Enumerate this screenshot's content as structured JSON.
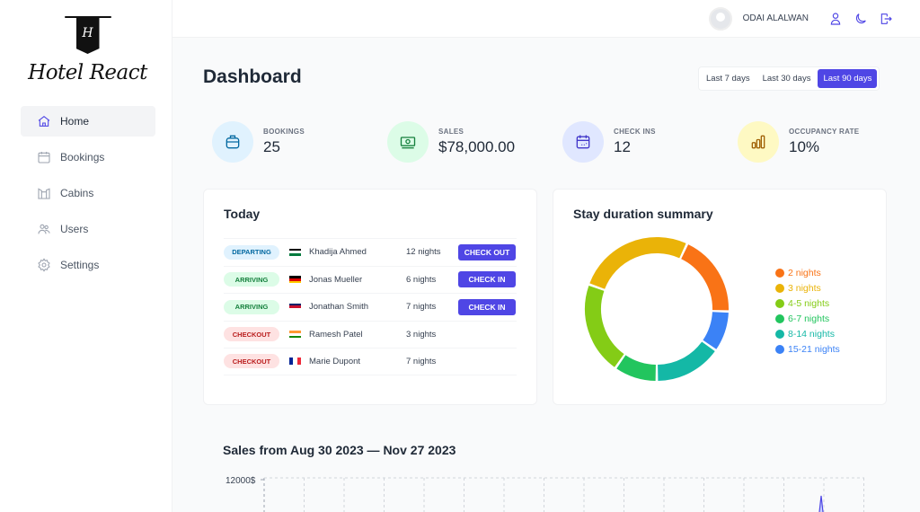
{
  "brand": {
    "logo_letter": "H",
    "name": "Hotel React"
  },
  "sidebar": {
    "items": [
      {
        "label": "Home",
        "icon": "home-icon"
      },
      {
        "label": "Bookings",
        "icon": "calendar-icon"
      },
      {
        "label": "Cabins",
        "icon": "cabins-icon"
      },
      {
        "label": "Users",
        "icon": "users-icon"
      },
      {
        "label": "Settings",
        "icon": "gear-icon"
      }
    ]
  },
  "header": {
    "user": "ODAI ALALWAN"
  },
  "page": {
    "title": "Dashboard"
  },
  "filters": [
    "Last 7 days",
    "Last 30 days",
    "Last 90 days"
  ],
  "stats": [
    {
      "label": "BOOKINGS",
      "value": "25",
      "color": "#e0f2fe",
      "icon": "briefcase-icon"
    },
    {
      "label": "SALES",
      "value": "$78,000.00",
      "color": "#dcfce7",
      "icon": "banknotes-icon"
    },
    {
      "label": "CHECK INS",
      "value": "12",
      "color": "#e0e7ff",
      "icon": "calendar-icon"
    },
    {
      "label": "OCCUPANCY RATE",
      "value": "10%",
      "color": "#fef9c3",
      "icon": "chart-bar-icon"
    }
  ],
  "today": {
    "title": "Today",
    "rows": [
      {
        "status": "DEPARTING",
        "guest": "Khadija Ahmed",
        "nights": "12 nights",
        "action": "CHECK OUT"
      },
      {
        "status": "ARRIVING",
        "guest": "Jonas Mueller",
        "nights": "6 nights",
        "action": "CHECK IN"
      },
      {
        "status": "ARRIVING",
        "guest": "Jonathan Smith",
        "nights": "7 nights",
        "action": "CHECK IN"
      },
      {
        "status": "CHECKOUT",
        "guest": "Ramesh Patel",
        "nights": "3 nights",
        "action": null
      },
      {
        "status": "CHECKOUT",
        "guest": "Marie Dupont",
        "nights": "7 nights",
        "action": null
      }
    ]
  },
  "chart_data": [
    {
      "type": "pie",
      "title": "Stay duration summary",
      "categories": [
        "2 nights",
        "3 nights",
        "4-5 nights",
        "6-7 nights",
        "8-14 nights",
        "15-21 nights"
      ],
      "values": [
        67,
        95,
        75,
        35,
        55,
        33
      ],
      "colors": [
        "#f97316",
        "#eab308",
        "#84cc16",
        "#22c55e",
        "#14b8a6",
        "#3b82f6"
      ],
      "legend": "right"
    },
    {
      "type": "area",
      "title": "Sales from Aug 30 2023 — Nov 27 2023",
      "ytick_labels": [
        "12000$"
      ]
    }
  ]
}
